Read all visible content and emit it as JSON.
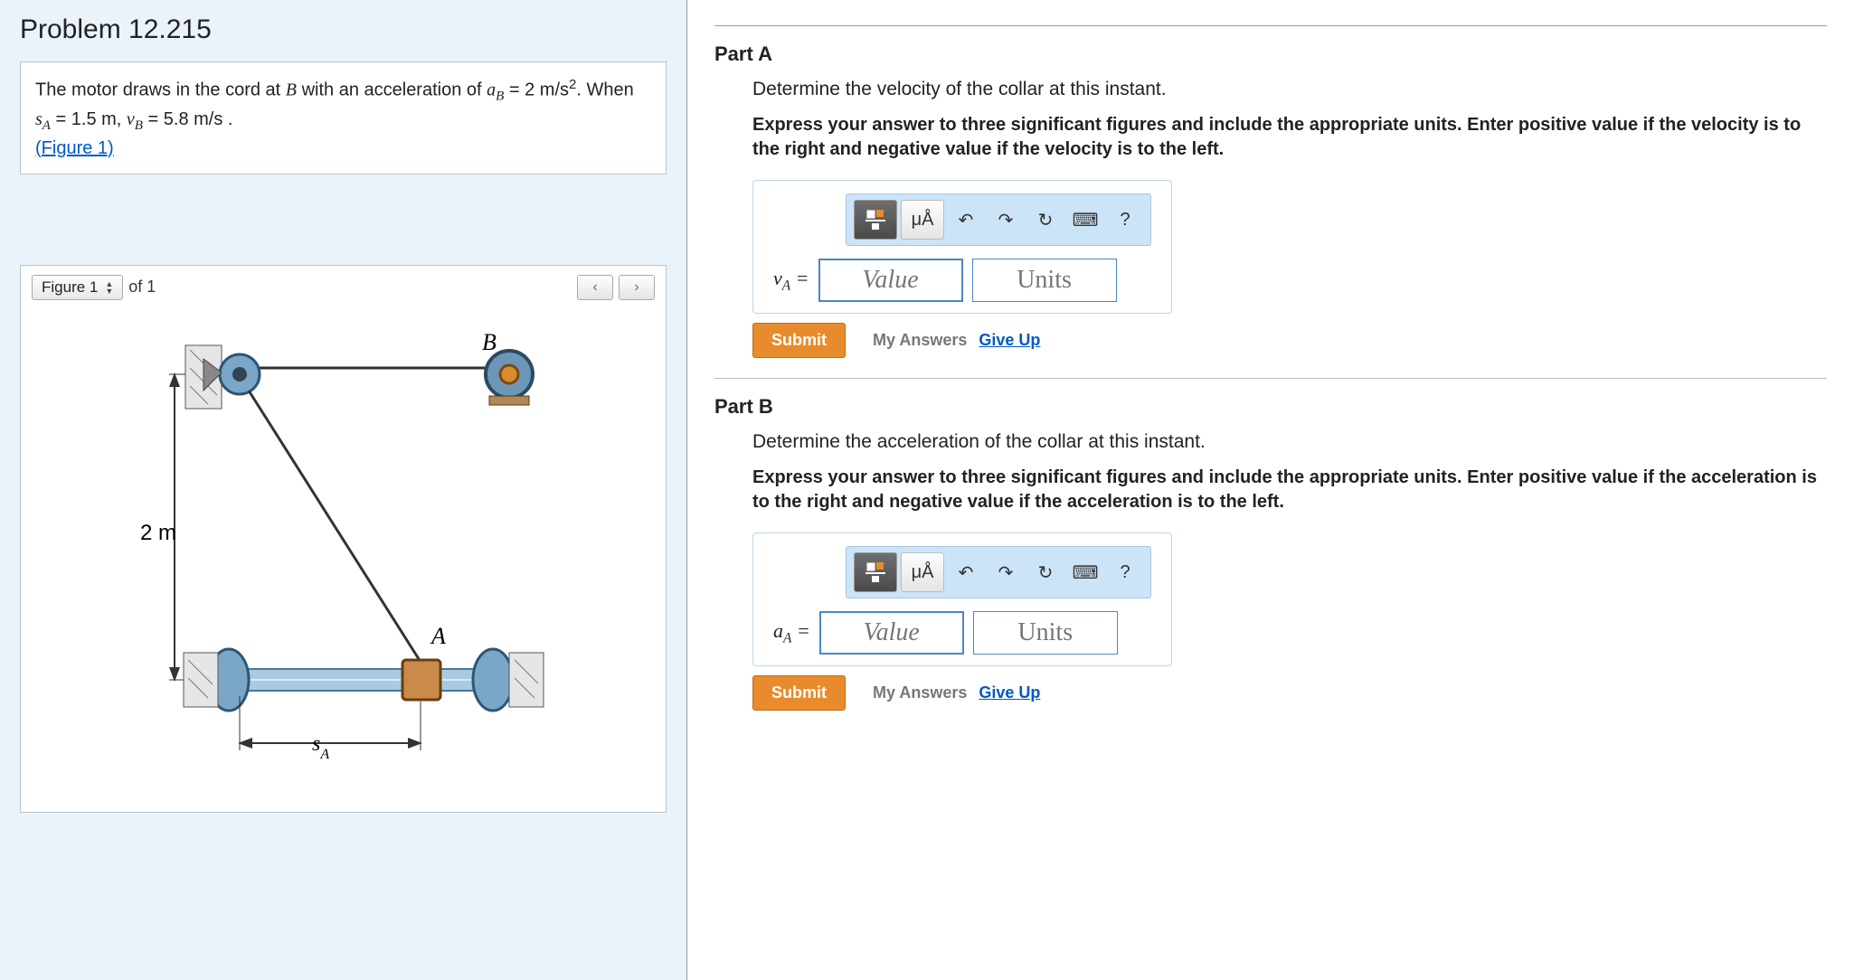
{
  "problem": {
    "title": "Problem 12.215",
    "desc_prefix": "The motor draws in the cord at ",
    "desc_B": "B",
    "desc_mid": " with an acceleration of ",
    "aB_eq": "a",
    "aB_sub": "B",
    "aB_val": " = 2 m/s",
    "aB_sup": "2",
    "desc_when": ". When ",
    "sA": "s",
    "sA_sub": "A",
    "sA_val": " = 1.5 m, ",
    "vB": "v",
    "vB_sub": "B",
    "vB_val": " = 5.8  m/s .",
    "figure_link": "(Figure 1)"
  },
  "figure": {
    "selector": "Figure 1",
    "of_text": "of 1",
    "label_B": "B",
    "label_A": "A",
    "label_2m": "2 m",
    "label_sA": "s",
    "label_sA_sub": "A"
  },
  "partA": {
    "title": "Part A",
    "question": "Determine the velocity of the collar at this instant.",
    "instructions": "Express your answer to three significant figures and include the appropriate units. Enter positive value if the velocity is to the right and negative value if the velocity is to the left.",
    "var": "v",
    "var_sub": "A",
    "eq": " = ",
    "value_ph": "Value",
    "units_ph": "Units",
    "submit": "Submit",
    "my_answers": "My Answers",
    "give_up": "Give Up"
  },
  "partB": {
    "title": "Part B",
    "question": "Determine the acceleration of the collar at this instant.",
    "instructions": "Express your answer to three significant figures and include the appropriate units. Enter positive value if the acceleration is to the right and negative value if the acceleration is to the left.",
    "var": "a",
    "var_sub": "A",
    "eq": " = ",
    "value_ph": "Value",
    "units_ph": "Units",
    "submit": "Submit",
    "my_answers": "My Answers",
    "give_up": "Give Up"
  },
  "toolbar": {
    "units_label": "μÅ",
    "help": "?"
  }
}
